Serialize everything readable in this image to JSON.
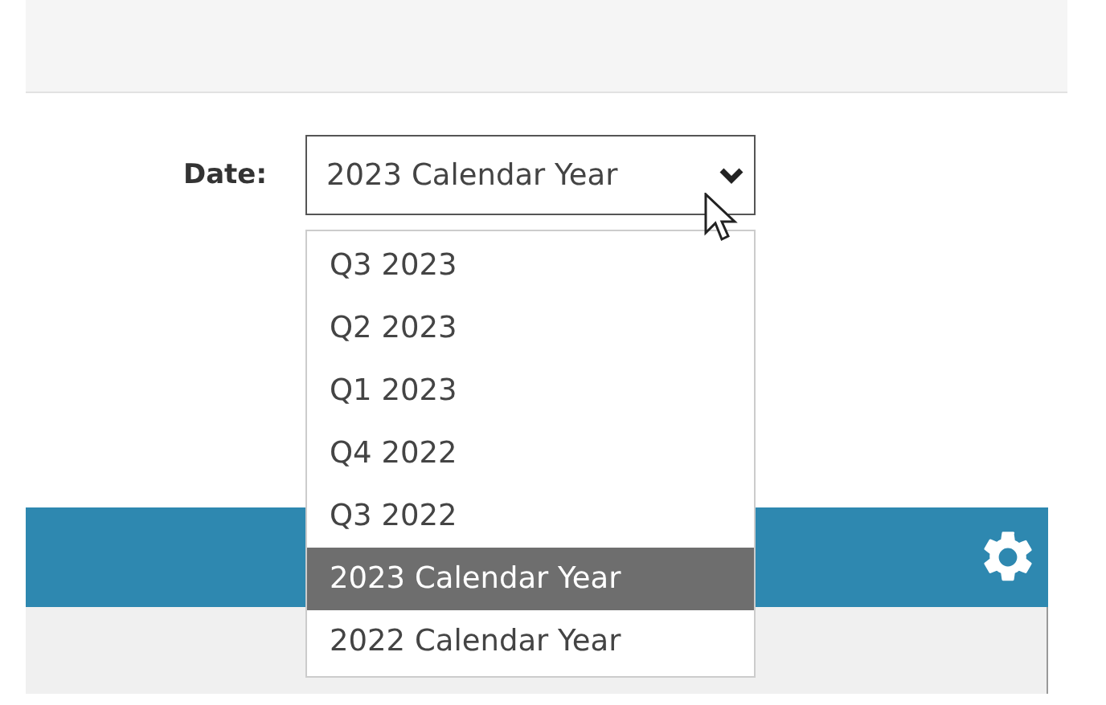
{
  "filter": {
    "label": "Date:",
    "value": "2023 Calendar Year"
  },
  "dropdown": {
    "options": [
      {
        "label": "Q3 2023",
        "selected": false
      },
      {
        "label": "Q2 2023",
        "selected": false
      },
      {
        "label": "Q1 2023",
        "selected": false
      },
      {
        "label": "Q4 2022",
        "selected": false
      },
      {
        "label": "Q3 2022",
        "selected": false
      },
      {
        "label": "2023 Calendar Year",
        "selected": true
      },
      {
        "label": "2022 Calendar Year",
        "selected": false
      }
    ]
  }
}
